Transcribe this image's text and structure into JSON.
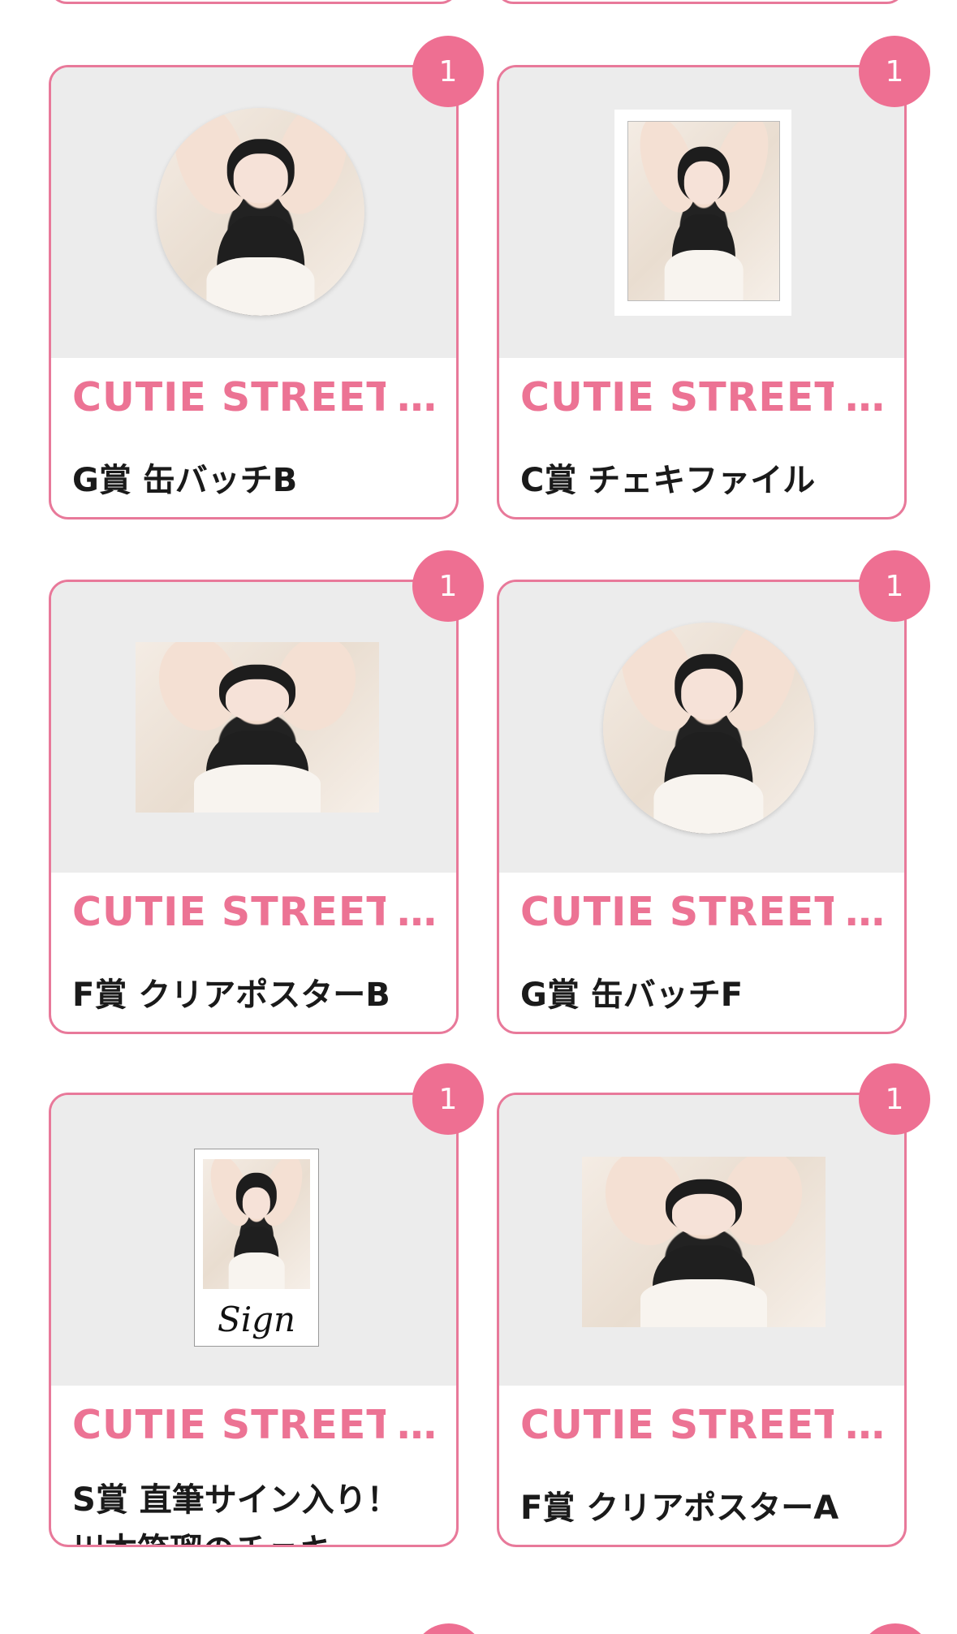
{
  "badge_color": "#ee6f92",
  "border_color": "#e8799a",
  "title_color": "#ec7394",
  "cards": [
    {
      "title": "CUTIE STREET",
      "ellipsis": "…",
      "name": "G賞 缶バッチB",
      "count": "1",
      "image": "round-badge"
    },
    {
      "title": "CUTIE STREET",
      "ellipsis": "…",
      "name": "C賞 チェキファイル",
      "count": "1",
      "image": "file"
    },
    {
      "title": "CUTIE STREET",
      "ellipsis": "…",
      "name": "F賞 クリアポスターB",
      "count": "1",
      "image": "poster"
    },
    {
      "title": "CUTIE STREET",
      "ellipsis": "…",
      "name": "G賞 缶バッチF",
      "count": "1",
      "image": "round-badge"
    },
    {
      "title": "CUTIE STREET",
      "ellipsis": "…",
      "name": "S賞 直筆サイン入り！川本笑瑠のチェキ",
      "count": "1",
      "image": "cheki",
      "sign_text": "Sign"
    },
    {
      "title": "CUTIE STREET",
      "ellipsis": "…",
      "name": "F賞 クリアポスターA",
      "count": "1",
      "image": "poster"
    }
  ]
}
